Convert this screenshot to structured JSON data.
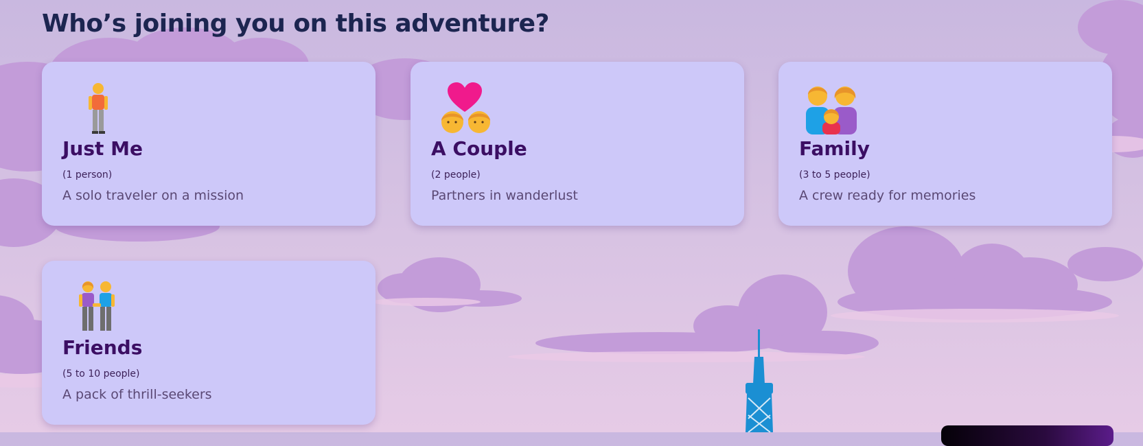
{
  "page": {
    "title": "Who’s joining you on this adventure?"
  },
  "options": [
    {
      "name": "Just Me",
      "count": "(1 person)",
      "description": "A solo traveler on a mission",
      "icon": "person-standing-icon"
    },
    {
      "name": "A Couple",
      "count": "(2 people)",
      "description": "Partners in wanderlust",
      "icon": "couple-with-heart-icon"
    },
    {
      "name": "Family",
      "count": "(3 to 5 people)",
      "description": "A crew ready for memories",
      "icon": "family-icon"
    },
    {
      "name": "Friends",
      "count": "(5 to 10 people)",
      "description": "A pack of thrill-seekers",
      "icon": "people-holding-hands-icon"
    }
  ],
  "colors": {
    "card_background": "#cdc8f9",
    "title": "#1c2550",
    "card_heading": "#3b0e63",
    "cloud": "#c39cd9",
    "tower": "#1b8fd3"
  }
}
